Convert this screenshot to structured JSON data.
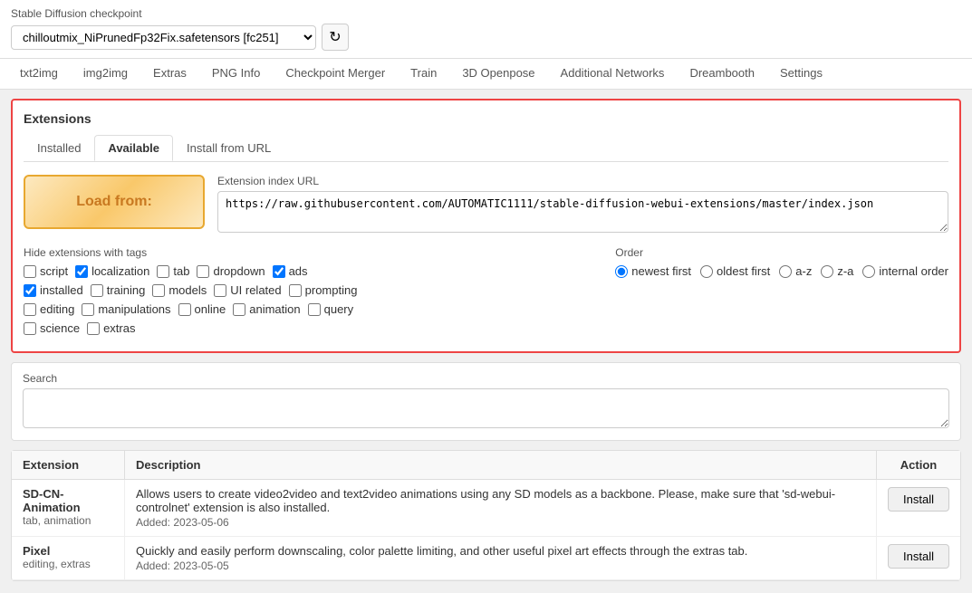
{
  "checkpoint": {
    "label": "Stable Diffusion checkpoint",
    "value": "chilloutmix_NiPrunedFp32Fix.safetensors [fc251]",
    "refresh_title": "Refresh"
  },
  "main_tabs": [
    {
      "label": "txt2img",
      "id": "txt2img"
    },
    {
      "label": "img2img",
      "id": "img2img"
    },
    {
      "label": "Extras",
      "id": "extras"
    },
    {
      "label": "PNG Info",
      "id": "png-info"
    },
    {
      "label": "Checkpoint Merger",
      "id": "checkpoint-merger"
    },
    {
      "label": "Train",
      "id": "train"
    },
    {
      "label": "3D Openpose",
      "id": "3d-openpose"
    },
    {
      "label": "Additional Networks",
      "id": "additional-networks"
    },
    {
      "label": "Dreambooth",
      "id": "dreambooth"
    },
    {
      "label": "Settings",
      "id": "settings"
    }
  ],
  "panel": {
    "title": "Extensions",
    "sub_tabs": [
      {
        "label": "Installed",
        "active": false
      },
      {
        "label": "Available",
        "active": true
      },
      {
        "label": "Install from URL",
        "active": false
      }
    ],
    "load_from_label": "Load from:",
    "url_label": "Extension index URL",
    "url_value": "https://raw.githubusercontent.com/AUTOMATIC1111/stable-diffusion-webui-extensions/master/index.json",
    "hide_tags_label": "Hide extensions with tags",
    "order_label": "Order",
    "checkboxes": [
      {
        "id": "cb-script",
        "label": "script",
        "checked": false
      },
      {
        "id": "cb-localization",
        "label": "localization",
        "checked": true
      },
      {
        "id": "cb-tab",
        "label": "tab",
        "checked": false
      },
      {
        "id": "cb-dropdown",
        "label": "dropdown",
        "checked": false
      },
      {
        "id": "cb-ads",
        "label": "ads",
        "checked": true
      },
      {
        "id": "cb-installed",
        "label": "installed",
        "checked": true
      },
      {
        "id": "cb-training",
        "label": "training",
        "checked": false
      },
      {
        "id": "cb-models",
        "label": "models",
        "checked": false
      },
      {
        "id": "cb-ui-related",
        "label": "UI related",
        "checked": false
      },
      {
        "id": "cb-prompting",
        "label": "prompting",
        "checked": false
      },
      {
        "id": "cb-editing",
        "label": "editing",
        "checked": false
      },
      {
        "id": "cb-manipulations",
        "label": "manipulations",
        "checked": false
      },
      {
        "id": "cb-online",
        "label": "online",
        "checked": false
      },
      {
        "id": "cb-animation",
        "label": "animation",
        "checked": false
      },
      {
        "id": "cb-query",
        "label": "query",
        "checked": false
      },
      {
        "id": "cb-science",
        "label": "science",
        "checked": false
      },
      {
        "id": "cb-extras",
        "label": "extras",
        "checked": false
      }
    ],
    "order_options": [
      {
        "id": "ord-newest",
        "label": "newest first",
        "checked": true
      },
      {
        "id": "ord-oldest",
        "label": "oldest first",
        "checked": false
      },
      {
        "id": "ord-az",
        "label": "a-z",
        "checked": false
      },
      {
        "id": "ord-za",
        "label": "z-a",
        "checked": false
      },
      {
        "id": "ord-internal",
        "label": "internal order",
        "checked": false
      }
    ]
  },
  "search": {
    "label": "Search",
    "placeholder": ""
  },
  "table": {
    "headers": [
      "Extension",
      "Description",
      "Action"
    ],
    "rows": [
      {
        "name": "SD-CN-Animation",
        "tags": "tab, animation",
        "description": "Allows users to create video2video and text2video animations using any SD models as a backbone. Please, make sure that 'sd-webui-controlnet' extension is also installed.",
        "added": "Added: 2023-05-06",
        "action": "Install"
      },
      {
        "name": "Pixel",
        "tags": "editing, extras",
        "description": "Quickly and easily perform downscaling, color palette limiting, and other useful pixel art effects through the extras tab.",
        "added": "Added: 2023-05-05",
        "action": "Install"
      }
    ]
  }
}
